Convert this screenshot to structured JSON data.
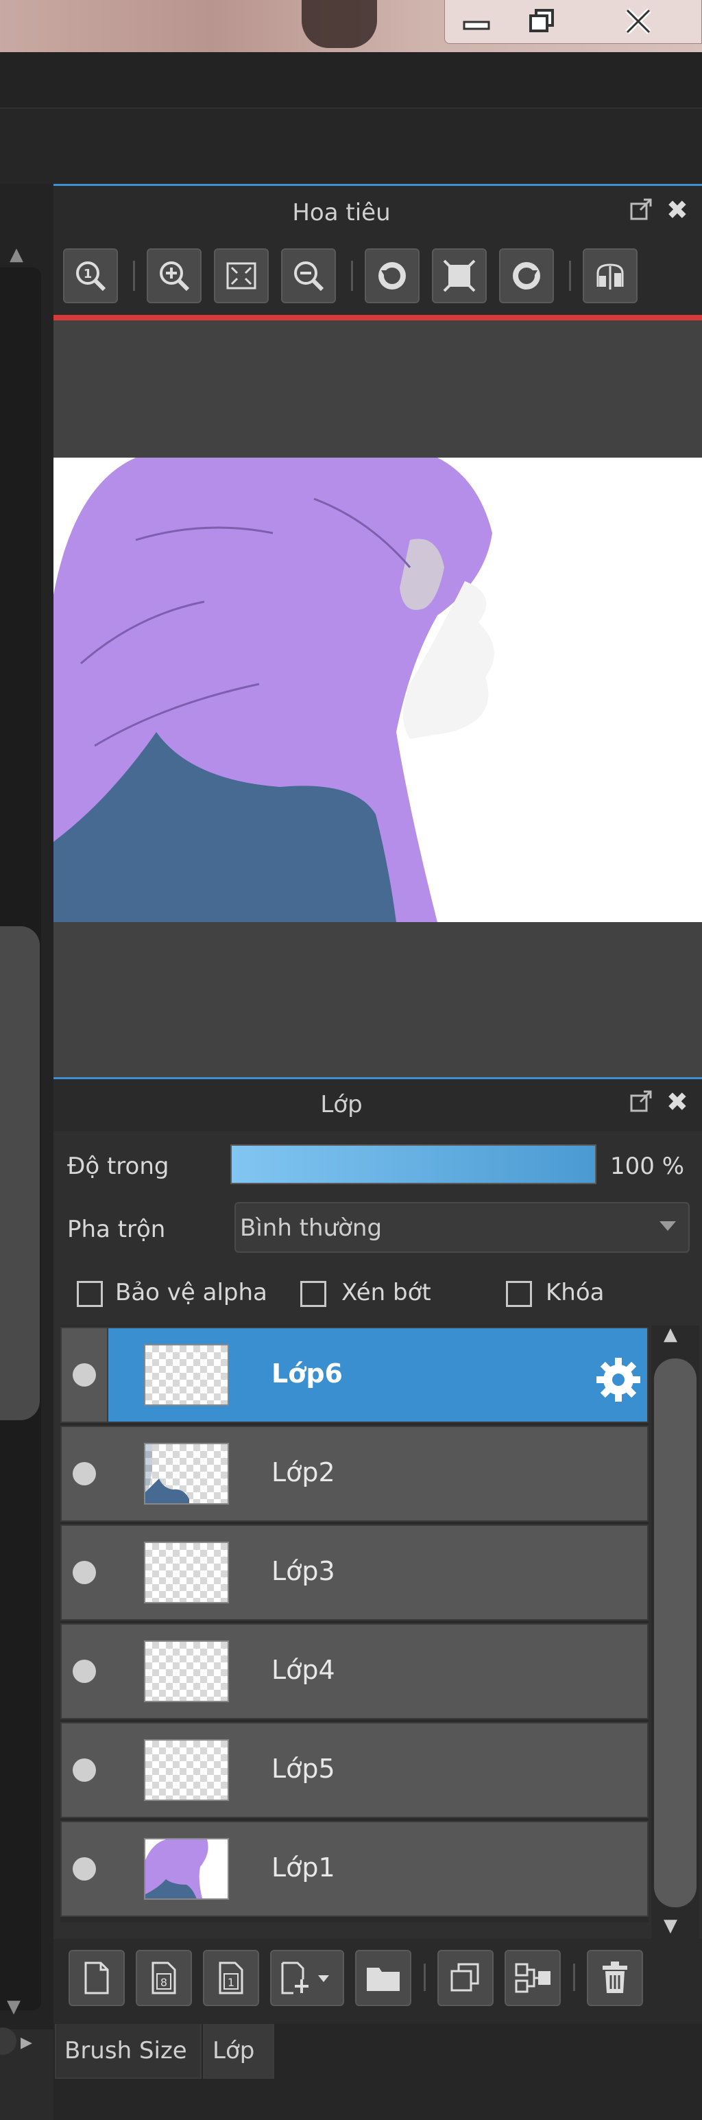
{
  "window": {
    "controls": {
      "minimize_icon": "minimize-icon",
      "maximize_icon": "restore-icon",
      "close_icon": "close-icon"
    }
  },
  "navigator": {
    "title": "Hoa tiêu",
    "tools": [
      "zoom-actual-icon",
      "zoom-in-icon",
      "fit-screen-icon",
      "zoom-out-icon",
      "rotate-left-icon",
      "fit-rotate-icon",
      "rotate-right-icon",
      "flip-icon"
    ]
  },
  "layers": {
    "title": "Lớp",
    "opacity_label": "Độ trong",
    "opacity_value": "100 %",
    "opacity_fraction": 1.0,
    "blend_label": "Pha trộn",
    "blend_value": "Bình thường",
    "checkboxes": [
      {
        "label": "Bảo vệ alpha",
        "checked": false
      },
      {
        "label": "Xén bớt",
        "checked": false
      },
      {
        "label": "Khóa",
        "checked": false
      }
    ],
    "items": [
      {
        "name": "Lớp6",
        "selected": true,
        "visible": true
      },
      {
        "name": "Lớp2",
        "selected": false,
        "visible": true
      },
      {
        "name": "Lớp3",
        "selected": false,
        "visible": true
      },
      {
        "name": "Lớp4",
        "selected": false,
        "visible": true
      },
      {
        "name": "Lớp5",
        "selected": false,
        "visible": true
      },
      {
        "name": "Lớp1",
        "selected": false,
        "visible": true
      }
    ],
    "toolbar": [
      "new-layer-icon",
      "new-8bit-layer-icon",
      "new-1bit-layer-icon",
      "add-layer-menu-icon",
      "new-folder-icon",
      "duplicate-layer-icon",
      "merge-down-icon",
      "delete-layer-icon"
    ]
  },
  "tabs": [
    {
      "label": "Brush Size",
      "active": false
    },
    {
      "label": "Lớp",
      "active": true
    }
  ],
  "colors": {
    "accent": "#3e8fd3",
    "selected_row": "#3a8fd0",
    "hair": "#b48ee8",
    "shirt": "#466a92",
    "redline": "#d63a3a"
  }
}
